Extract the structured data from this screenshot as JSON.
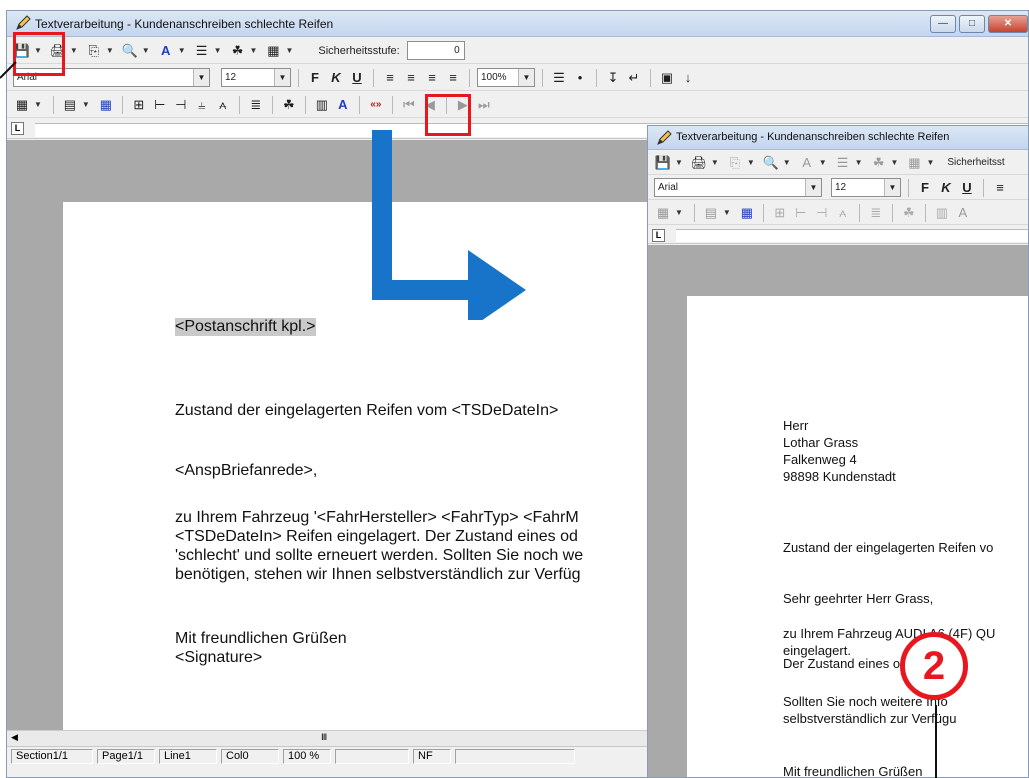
{
  "main_window": {
    "title": "Textverarbeitung - Kundenanschreiben schlechte Reifen",
    "buttons": {
      "minimize": "—",
      "maximize": "□",
      "close": "✕"
    },
    "security_label": "Sicherheitsstufe:",
    "security_value": "0",
    "font_name": "Arial",
    "font_size": "12",
    "bold_label": "F",
    "italic_label": "K",
    "underline_label": "U",
    "zoom": "100%",
    "document": {
      "address_field": "<Postanschrift kpl.>",
      "subject": "Zustand der eingelagerten Reifen vom <TSDeDateIn>",
      "salutation": "<AnspBriefanrede>,",
      "body_lines": [
        "zu Ihrem Fahrzeug '<FahrHersteller> <FahrTyp> <FahrM",
        "<TSDeDateIn> Reifen eingelagert. Der Zustand eines od",
        "'schlecht' und sollte erneuert werden. Sollten Sie noch we",
        "benötigen, stehen wir Ihnen selbstverständlich zur Verfüg"
      ],
      "closing": "Mit freundlichen Grüßen",
      "signature": "<Signature>"
    },
    "statusbar": [
      "Section1/1",
      "Page1/1",
      "Line1",
      "Col0",
      "100 %",
      "",
      "NF",
      ""
    ]
  },
  "preview_window": {
    "title": "Textverarbeitung - Kundenanschreiben schlechte Reifen",
    "security_label": "Sicherheitsst",
    "font_name": "Arial",
    "font_size": "12",
    "bold_label": "F",
    "italic_label": "K",
    "underline_label": "U",
    "document": {
      "address": [
        "Herr",
        "Lothar Grass",
        "Falkenweg 4",
        "98898 Kundenstadt"
      ],
      "subject": "Zustand der eingelagerten Reifen vo",
      "salutation": "Sehr geehrter Herr Grass,",
      "body_lines": [
        "zu Ihrem Fahrzeug AUDI A6 (4F) QU",
        "eingelagert.",
        "Der Zustand eines oder meh"
      ],
      "more_lines": [
        "Sollten Sie noch weitere Info",
        "selbstverständlich zur Verfügu"
      ],
      "closing_partial": "Mit freundlichen Grüßen"
    }
  },
  "annotations": {
    "step_badge": "2",
    "highlight_color": "#e8171f",
    "arrow_color": "#1874c8"
  },
  "icons": [
    "pencil-icon",
    "save-icon",
    "print-icon",
    "copy-icon",
    "find-icon",
    "font-color-icon",
    "paragraph-icon",
    "grow-icon",
    "table-icon",
    "merge-field-icon",
    "align-left-icon",
    "align-center-icon",
    "align-right-icon",
    "justify-icon",
    "list-icon",
    "bullet-icon"
  ]
}
